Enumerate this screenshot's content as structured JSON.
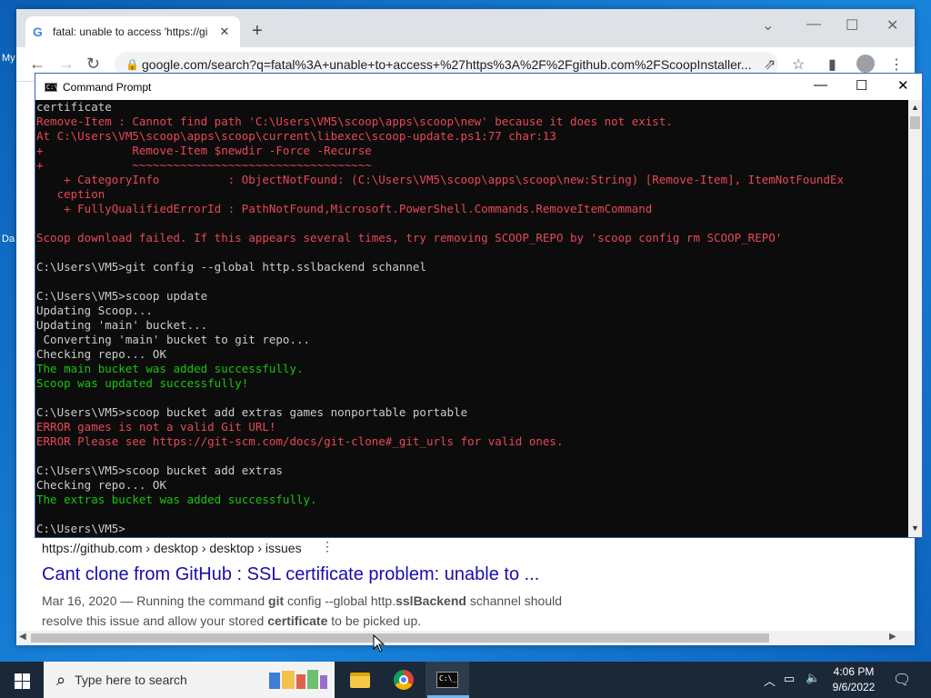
{
  "desktop": {
    "label_my": "My",
    "label_da": "Da"
  },
  "browser": {
    "tab_title": "fatal: unable to access 'https://gi",
    "new_tab": "+",
    "url": "google.com/search?q=fatal%3A+unable+to+access+%27https%3A%2F%2Fgithub.com%2FScoopInstaller..."
  },
  "cmd": {
    "title": "Command Prompt",
    "lines": [
      {
        "t": "certificate",
        "c": "w"
      },
      {
        "t": "Remove-Item : Cannot find path 'C:\\Users\\VM5\\scoop\\apps\\scoop\\new' because it does not exist.",
        "c": "r"
      },
      {
        "t": "At C:\\Users\\VM5\\scoop\\apps\\scoop\\current\\libexec\\scoop-update.ps1:77 char:13",
        "c": "r"
      },
      {
        "t": "+             Remove-Item $newdir -Force -Recurse",
        "c": "r"
      },
      {
        "t": "+             ~~~~~~~~~~~~~~~~~~~~~~~~~~~~~~~~~~~",
        "c": "r"
      },
      {
        "t": "    + CategoryInfo          : ObjectNotFound: (C:\\Users\\VM5\\scoop\\apps\\scoop\\new:String) [Remove-Item], ItemNotFoundEx",
        "c": "r"
      },
      {
        "t": "   ception",
        "c": "r"
      },
      {
        "t": "    + FullyQualifiedErrorId : PathNotFound,Microsoft.PowerShell.Commands.RemoveItemCommand",
        "c": "r"
      },
      {
        "t": "",
        "c": "w"
      },
      {
        "t": "Scoop download failed. If this appears several times, try removing SCOOP_REPO by 'scoop config rm SCOOP_REPO'",
        "c": "r"
      },
      {
        "t": "",
        "c": "w"
      },
      {
        "t": "C:\\Users\\VM5>git config --global http.sslbackend schannel",
        "c": "w"
      },
      {
        "t": "",
        "c": "w"
      },
      {
        "t": "C:\\Users\\VM5>scoop update",
        "c": "w"
      },
      {
        "t": "Updating Scoop...",
        "c": "w"
      },
      {
        "t": "Updating 'main' bucket...",
        "c": "w"
      },
      {
        "t": " Converting 'main' bucket to git repo...",
        "c": "w"
      },
      {
        "t": "Checking repo... OK",
        "c": "w"
      },
      {
        "t": "The main bucket was added successfully.",
        "c": "g"
      },
      {
        "t": "Scoop was updated successfully!",
        "c": "g"
      },
      {
        "t": "",
        "c": "w"
      },
      {
        "t": "C:\\Users\\VM5>scoop bucket add extras games nonportable portable",
        "c": "w"
      },
      {
        "t": "ERROR games is not a valid Git URL!",
        "c": "r"
      },
      {
        "t": "ERROR Please see https://git-scm.com/docs/git-clone#_git_urls for valid ones.",
        "c": "r"
      },
      {
        "t": "",
        "c": "w"
      },
      {
        "t": "C:\\Users\\VM5>scoop bucket add extras",
        "c": "w"
      },
      {
        "t": "Checking repo... OK",
        "c": "w"
      },
      {
        "t": "The extras bucket was added successfully.",
        "c": "g"
      },
      {
        "t": "",
        "c": "w"
      },
      {
        "t": "C:\\Users\\VM5>",
        "c": "w"
      }
    ]
  },
  "result": {
    "cite": "https://github.com › desktop › desktop › issues",
    "title": "Cant clone from GitHub : SSL certificate problem: unable to ...",
    "snippet_date": "Mar 16, 2020",
    "snippet_sep": " — Running the command ",
    "snippet_b1": "git",
    "snippet_t2": " config --global http.",
    "snippet_b2": "sslBackend",
    "snippet_t3": " schannel should resolve this issue and allow your stored ",
    "snippet_b3": "certificate",
    "snippet_t4": " to be picked up."
  },
  "taskbar": {
    "search_placeholder": "Type here to search",
    "time": "4:06 PM",
    "date": "9/6/2022"
  },
  "colors": {
    "red": "#e74856",
    "green": "#16c60c",
    "white": "#cccccc",
    "link": "#1a0dab"
  }
}
